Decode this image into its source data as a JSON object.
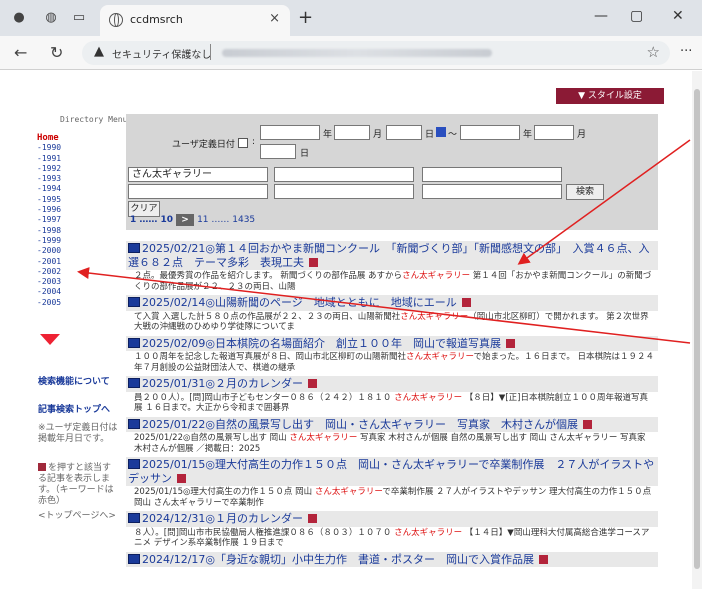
{
  "browser": {
    "tab_title": "ccdmsrch",
    "security_label": "セキュリティ保護なし",
    "new_tab": "+",
    "close_tab": "×",
    "win_min": "—",
    "win_max": "▢",
    "win_close": "✕",
    "star": "☆",
    "more": "···"
  },
  "style_button": "▼ スタイル設定",
  "sidebar": {
    "directory_menu": "Directory Menu",
    "home": "Home",
    "years": [
      "-1990",
      "-1991",
      "-1992",
      "-1993",
      "-1994",
      "-1995",
      "-1996",
      "-1997",
      "-1998",
      "-1999",
      "-2000",
      "-2001",
      "-2002",
      "-2003",
      "-2004",
      "-2005"
    ],
    "search_help": "検索機能について",
    "search_top": "記事検索トップへ",
    "note1": "※ユーザ定義日付は掲載年月日です。",
    "note2": "を押すと該当する記事を表示します。（キーワードは赤色）",
    "top_page": "<トップページへ>"
  },
  "search": {
    "user_date_label": "ユーザ定義日付",
    "year": "年",
    "month": "月",
    "day": "日",
    "tilde": "～",
    "keyword_value": "さん太ギャラリー",
    "search_btn": "検索",
    "clear_btn": "クリア",
    "pager_prev": "1 …… 10",
    "pager_next": "11 …… 1435"
  },
  "articles": [
    {
      "title": "2025/02/21◎第１４回おかやま新聞コンクール　「新聞づくり部」「新聞感想文の部」　入賞４６点、入選６８２点　テーマ多彩　表現工夫",
      "body_pre": "２点。最優秀賞の作品を紹介します。 新聞づくりの部作品展 あすから",
      "keyword": "さん太ギャラリー",
      "body_post": " 第１４回「おかやま新聞コンクール」の新聞づくりの部作品展が２２、２３の両日、山陽"
    },
    {
      "title": "2025/02/14◎山陽新聞のページ　地域とともに　地域にエール",
      "body_pre": "て入賞 入選した計５８０点の作品展が２２、２３の両日、山陽新聞社",
      "keyword": "さん太ギャラリー",
      "body_post": "（岡山市北区柳町）で開かれます。 第２次世界大戦の沖縄戦のひめゆり学徒隊についてま"
    },
    {
      "title": "2025/02/09◎日本棋院の名場面紹介　創立１００年　岡山で報道写真展",
      "body_pre": "１００周年を記念した報道写真展が８日、岡山市北区柳町の山陽新聞社",
      "keyword": "さん太ギャラリー",
      "body_post": "で始まった。１６日まで。 日本棋院は１９２４年７月創設の公益財団法人で、棋道の継承"
    },
    {
      "title": "2025/01/31◎２月のカレンダー",
      "body_pre": "員２００人）。[問]岡山市子どもセンター０８６（２４２）１８１０ ",
      "keyword": "さん太ギャラリー",
      "body_post": " 【８日】▼[正]日本棋院創立１００周年報道写真展 １６日まで。大正から令和まで囲碁界"
    },
    {
      "title": "2025/01/22◎自然の風景写し出す　岡山・さん太ギャラリー　写真家　木村さんが個展",
      "body_pre": "2025/01/22◎自然の風景写し出す 岡山 ",
      "keyword": "さん太ギャラリー",
      "body_post": " 写真家 木村さんが個展 自然の風景写し出す 岡山 さん太ギャラリー 写真家 木村さんが個展 ／掲載日：2025"
    },
    {
      "title": "2025/01/15◎理大付高生の力作１５０点　岡山・さん太ギャラリーで卒業制作展　２７人がイラストやデッサン",
      "body_pre": "2025/01/15◎理大付高生の力作１５０点 岡山 ",
      "keyword": "さん太ギャラリー",
      "body_post": "で卒業制作展 ２７人がイラストやデッサン 理大付高生の力作１５０点 岡山 さん太ギャラリーで卒業制作"
    },
    {
      "title": "2024/12/31◎１月のカレンダー",
      "body_pre": "８人）。[問]岡山市市民協働局人権推進課０８６（８０３）１０７０ ",
      "keyword": "さん太ギャラリー",
      "body_post": " 【１４日】▼岡山理科大付属高総合進学コースアニメ デザイン系卒業制作展 １９日まで"
    },
    {
      "title": "2024/12/17◎「身近な親切」小中生力作　書道・ポスター　岡山で入賞作品展",
      "body_pre": "",
      "keyword": "",
      "body_post": ""
    }
  ]
}
